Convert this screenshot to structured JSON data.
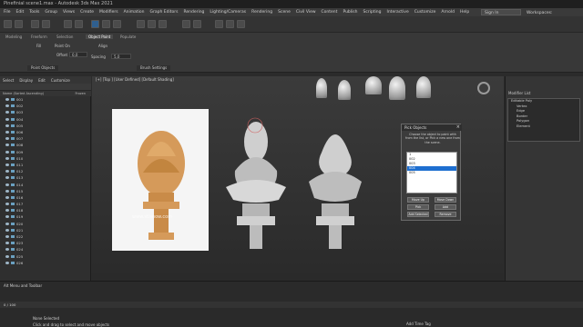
{
  "app": {
    "title": "Pinefinial scene1.max - Autodesk 3ds Max 2021"
  },
  "menubar": {
    "items": [
      "File",
      "Edit",
      "Tools",
      "Group",
      "Views",
      "Create",
      "Modifiers",
      "Animation",
      "Graph Editors",
      "Rendering",
      "Lighting/Cameras",
      "Rendering",
      "Scene",
      "Civil View",
      "Content",
      "Publish",
      "Scripting",
      "Interactive",
      "Customize",
      "Arnold",
      "Help"
    ],
    "signin": "Sign In",
    "workspaces": "Workspaces:",
    "workspace_value": "Alt Menu and Toolbar"
  },
  "ribbon": {
    "tabs": [
      "Modeling",
      "Freeform",
      "Selection",
      "Object Paint",
      "Populate"
    ],
    "active_tab": "Object Paint",
    "panel1_title": "Point Objects",
    "panel2_title": "Brush Settings",
    "labels": {
      "fill": "Fill",
      "offset": "Offset",
      "align": "Align",
      "spacing": "Spacing",
      "spacing_value": "5,0",
      "point_on": "Point On",
      "offset_value": "0,0"
    }
  },
  "scene_explorer": {
    "tabs": [
      "Select",
      "Display",
      "Edit",
      "Customize"
    ],
    "column_header": "Name (Sorted Ascending)",
    "col_freeze": "Frozen",
    "rows": [
      "001",
      "002",
      "003",
      "004",
      "005",
      "006",
      "007",
      "008",
      "009",
      "010",
      "011",
      "012",
      "013",
      "014",
      "015",
      "016",
      "017",
      "018",
      "019",
      "020",
      "021",
      "022",
      "023",
      "024",
      "025",
      "026"
    ]
  },
  "viewport": {
    "label": "[+] [Top ] [User Defined] [Default Shading]",
    "watermark": "www.stlsnow.com"
  },
  "dialog": {
    "title": "Pick Objects",
    "instruction": "Choose the object to paint with from the list, or Pick a new one from the scene.",
    "list": [
      "1",
      "002",
      "003",
      "004",
      "005"
    ],
    "selected": "004",
    "buttons": [
      "Move Up",
      "Move Down",
      "Pick",
      "Add",
      "Add Selected",
      "Remove"
    ]
  },
  "right_panel": {
    "label": "Modifier List",
    "modifiers": [
      "Editable Poly",
      "Vertex",
      "Edge",
      "Border",
      "Polygon",
      "Element"
    ]
  },
  "bottom": {
    "menus_label": "Alt Menu and Toolbar",
    "status1": "None Selected",
    "status2": "Click and drag to select and move objects",
    "add_time_tag": "Add Time Tag",
    "frame": "0 / 100"
  },
  "colors": {
    "accent": "#1e6fd0",
    "wood": "#d59a5a"
  }
}
